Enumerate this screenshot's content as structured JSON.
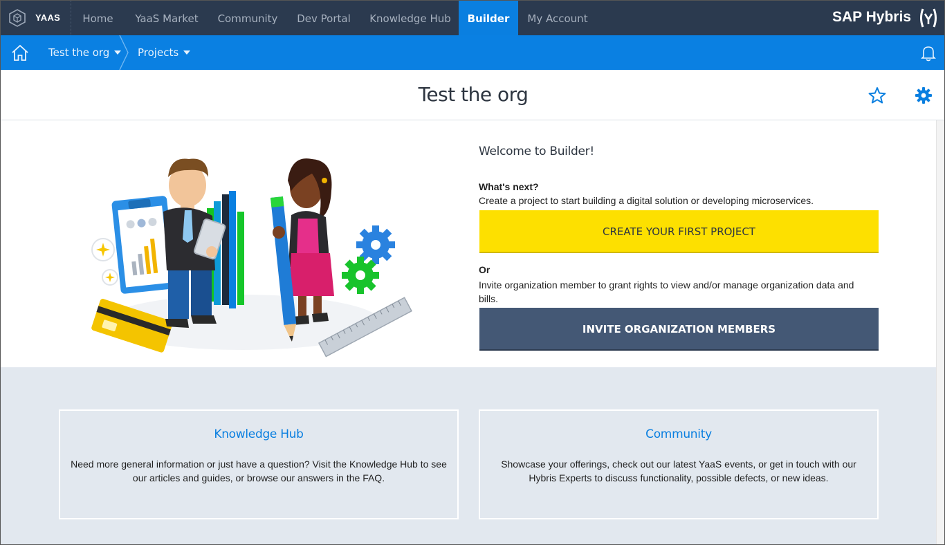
{
  "topnav": {
    "brand": "YAAS",
    "items": [
      {
        "label": "Home"
      },
      {
        "label": "YaaS Market"
      },
      {
        "label": "Community"
      },
      {
        "label": "Dev Portal"
      },
      {
        "label": "Knowledge Hub"
      },
      {
        "label": "Builder",
        "active": true
      },
      {
        "label": "My Account"
      }
    ],
    "vendor": "SAP Hybris"
  },
  "breadcrumb": {
    "org": "Test the org",
    "projects": "Projects"
  },
  "page": {
    "title": "Test the org"
  },
  "welcome": {
    "title": "Welcome to Builder!",
    "whats_next": "What's next?",
    "whats_next_desc": "Create a project to start building a digital solution or developing microservices.",
    "create_button": "CREATE YOUR FIRST PROJECT",
    "or": "Or",
    "or_desc": "Invite organization member to grant rights to view and/or manage organization data and bills.",
    "invite_button": "INVITE ORGANIZATION MEMBERS"
  },
  "cards": [
    {
      "title": "Knowledge Hub",
      "desc": "Need more general information or just have a question? Visit the Knowledge Hub to see our articles and guides, or browse our answers in the FAQ."
    },
    {
      "title": "Community",
      "desc": "Showcase your offerings, check out our latest YaaS events, or get in touch with our Hybris Experts to discuss functionality, possible defects, or new ideas."
    }
  ],
  "colors": {
    "topnav_bg": "#2b3a4f",
    "accent_blue": "#0a7fe0",
    "create_yellow": "#fde000",
    "invite_slate": "#445875",
    "info_bg": "#e2e8ef"
  },
  "icons": [
    "yaas-cube-icon",
    "home-icon",
    "chevron-separator-icon",
    "bell-icon",
    "star-icon",
    "gear-icon",
    "sap-hybris-logo-icon"
  ]
}
